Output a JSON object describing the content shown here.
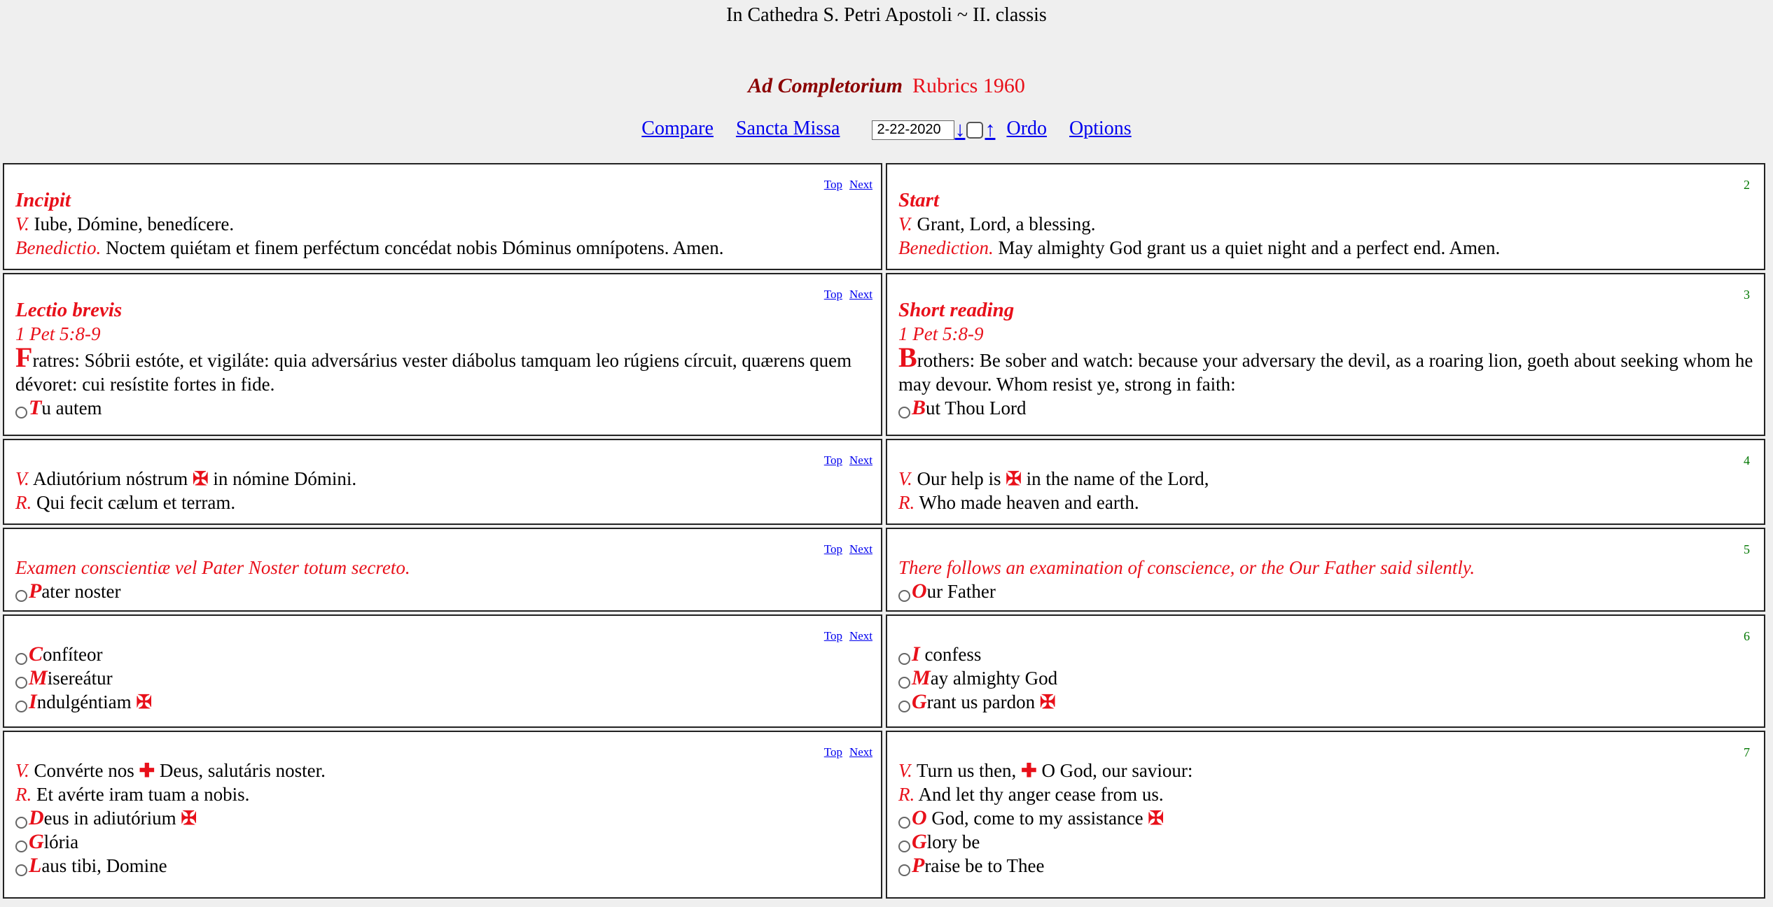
{
  "header": {
    "saint": "In Cathedra S. Petri Apostoli ~ II. classis",
    "hour": "Ad Completorium",
    "rubrics": "Rubrics 1960"
  },
  "nav": {
    "compare": "Compare",
    "sancta_missa": "Sancta Missa",
    "date": "2-22-2020",
    "down_arrow": "↓",
    "up_arrow": "↑",
    "ordo": "Ordo",
    "options": "Options"
  },
  "links": {
    "top": "Top",
    "next": "Next"
  },
  "sections": {
    "s1": {
      "num": "2",
      "la": {
        "heading": "Incipit",
        "v": "V.",
        "v_text": " Iube, Dómine, benedícere.",
        "b": "Benedictio.",
        "b_text": " Noctem quiétam et finem perféctum concédat nobis Dóminus omnípotens. Amen."
      },
      "en": {
        "heading": "Start",
        "v": "V.",
        "v_text": " Grant, Lord, a blessing.",
        "b": "Benediction.",
        "b_text": " May almighty God grant us a quiet night and a perfect end. Amen."
      }
    },
    "s2": {
      "num": "3",
      "la": {
        "heading": "Lectio brevis",
        "ref": "1 Pet 5:8-9",
        "cap": "F",
        "text": "ratres: Sóbrii estóte, et vigiláte: quia adversárius vester diábolus tamquam leo rúgiens círcuit, quærens quem dévoret: cui resístite fortes in fide.",
        "opt_cap": "T",
        "opt_text": "u autem"
      },
      "en": {
        "heading": "Short reading",
        "ref": "1 Pet 5:8-9",
        "cap": "B",
        "text": "rothers: Be sober and watch: because your adversary the devil, as a roaring lion, goeth about seeking whom he may devour. Whom resist ye, strong in faith:",
        "opt_cap": "B",
        "opt_text": "ut Thou Lord"
      }
    },
    "s3": {
      "num": "4",
      "la": {
        "v": "V.",
        "v_a": " Adiutórium nóstrum ",
        "v_b": " in nómine Dómini.",
        "r": "R.",
        "r_text": " Qui fecit cælum et terram."
      },
      "en": {
        "v": "V.",
        "v_a": " Our help is ",
        "v_b": " in the name of the Lord,",
        "r": "R.",
        "r_text": " Who made heaven and earth."
      }
    },
    "s4": {
      "num": "5",
      "la": {
        "rubric": "Examen conscientiæ vel Pater Noster totum secreto.",
        "opt_cap": "P",
        "opt_text": "ater noster"
      },
      "en": {
        "rubric": "There follows an examination of conscience, or the Our Father said silently.",
        "opt_cap": "O",
        "opt_text": "ur Father"
      }
    },
    "s5": {
      "num": "6",
      "la": {
        "o1_cap": "C",
        "o1": "onfíteor",
        "o2_cap": "M",
        "o2": "isereátur",
        "o3_cap": "I",
        "o3": "ndulgéntiam "
      },
      "en": {
        "o1_cap": "I",
        "o1": " confess",
        "o2_cap": "M",
        "o2": "ay almighty God",
        "o3_cap": "G",
        "o3": "rant us pardon "
      }
    },
    "s6": {
      "num": "7",
      "la": {
        "v": "V.",
        "v_a": " Convérte nos ",
        "v_b": " Deus, salutáris noster.",
        "r": "R.",
        "r_text": " Et avérte iram tuam a nobis.",
        "o1_cap": "D",
        "o1": "eus in adiutórium ",
        "o2_cap": "G",
        "o2": "lória",
        "o3_cap": "L",
        "o3": "aus tibi, Domine"
      },
      "en": {
        "v": "V.",
        "v_a": " Turn us then, ",
        "v_b": " O God, our saviour:",
        "r": "R.",
        "r_text": " And let thy anger cease from us.",
        "o1_cap": "O",
        "o1": " God, come to my assistance ",
        "o2_cap": "G",
        "o2": "lory be",
        "o3_cap": "P",
        "o3": "raise be to Thee"
      }
    }
  },
  "colors": {
    "rubric_red": "#e8101a",
    "hour_red": "#8b0000",
    "link_blue": "#0000ee",
    "number_green": "#007700"
  }
}
